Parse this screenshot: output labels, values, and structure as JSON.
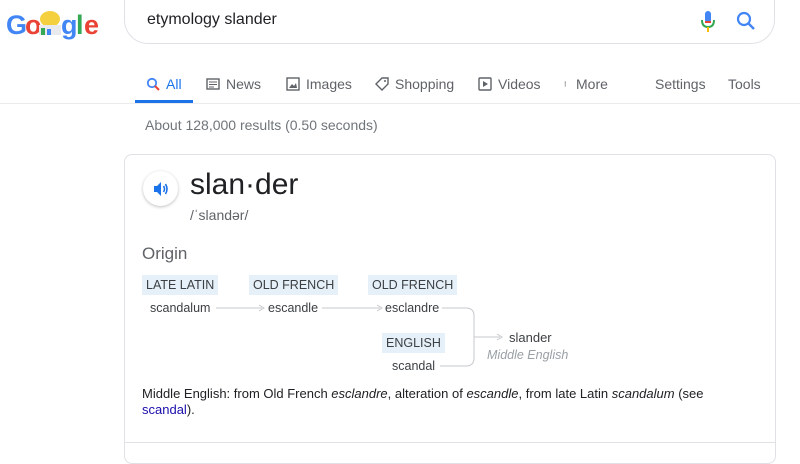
{
  "header": {
    "logo_text": "Google",
    "search_query": "etymology slander"
  },
  "tabs": {
    "all": "All",
    "news": "News",
    "images": "Images",
    "shopping": "Shopping",
    "videos": "Videos",
    "more": "More",
    "settings": "Settings",
    "tools": "Tools"
  },
  "results": {
    "stats": "About 128,000 results (0.50 seconds)"
  },
  "dictionary": {
    "word": "slan·der",
    "phonetic": "/ˈslandər/",
    "origin_label": "Origin",
    "chain": [
      {
        "lang": "LATE LATIN",
        "form": "scandalum"
      },
      {
        "lang": "OLD FRENCH",
        "form": "escandle"
      },
      {
        "lang": "OLD FRENCH",
        "form": "esclandre"
      },
      {
        "lang": "ENGLISH",
        "form": "scandal"
      }
    ],
    "result_form": "slander",
    "result_lang": "Middle English",
    "description": {
      "part1": "Middle English: from Old French ",
      "term1": "esclandre",
      "part2": ", alteration of ",
      "term2": "escandle",
      "part3": ", from late Latin ",
      "term3": "scandalum",
      "part4": " (see ",
      "link": "scandal",
      "part5": ")."
    }
  },
  "colors": {
    "accent": "#1a73e8",
    "label_bg": "#e6f0f9",
    "link": "#1a0dab"
  }
}
